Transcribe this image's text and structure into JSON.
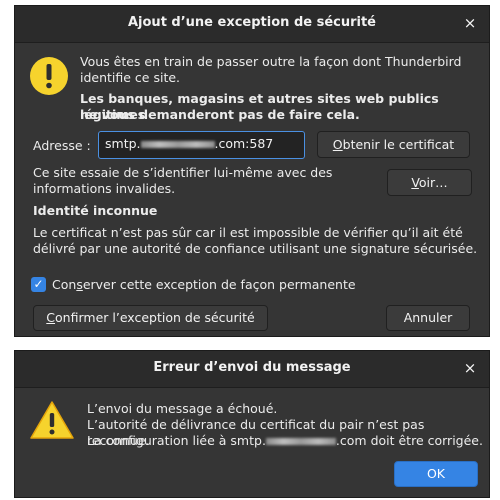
{
  "security_dialog": {
    "title": "Ajout d’une exception de sécurité",
    "close_glyph": "×",
    "icon": "warning-circle-icon",
    "intro_line1": "Vous êtes en train de passer outre la façon dont Thunderbird",
    "intro_line2": "identifie ce site.",
    "warning_line1": "Les banques, magasins et autres sites web publics légitimes",
    "warning_line2": "ne vous demanderont pas de faire cela.",
    "address_label": "Adresse :",
    "address_prefix": "smtp.",
    "address_suffix": ".com:587",
    "get_certificate_button_accel": "O",
    "get_certificate_button_rest": "btenir le certificat",
    "invalid_info_line1": "Ce site essaie de s’identifier lui-même avec des",
    "invalid_info_line2": "informations invalides.",
    "view_button_accel": "V",
    "view_button_rest": "oir…",
    "identity_heading": "Identité inconnue",
    "identity_line1": "Le certificat n’est pas sûr car il est impossible de vérifier qu’il ait été",
    "identity_line2": "délivré par une autorité de confiance utilisant une signature sécurisée.",
    "permanent_checkbox_checked": true,
    "permanent_label_pre": "Con",
    "permanent_label_accel": "s",
    "permanent_label_post": "erver cette exception de façon permanente",
    "confirm_button_accel": "C",
    "confirm_button_rest": "onfirmer l’exception de sécurité",
    "cancel_button": "Annuler"
  },
  "error_dialog": {
    "title": "Erreur d’envoi du message",
    "close_glyph": "×",
    "icon": "warning-triangle-icon",
    "line1": "L’envoi du message a échoué.",
    "line2": "L’autorité de délivrance du certificat du pair n’est pas reconnue.",
    "line3_prefix": "La configuration liée à smtp.",
    "line3_suffix": ".com doit être corrigée.",
    "ok_button": "OK"
  },
  "colors": {
    "dialog_bg": "#353535",
    "titlebar_bg": "#2b2b2b",
    "accent": "#3584e4",
    "warning_yellow": "#f6d32d"
  }
}
